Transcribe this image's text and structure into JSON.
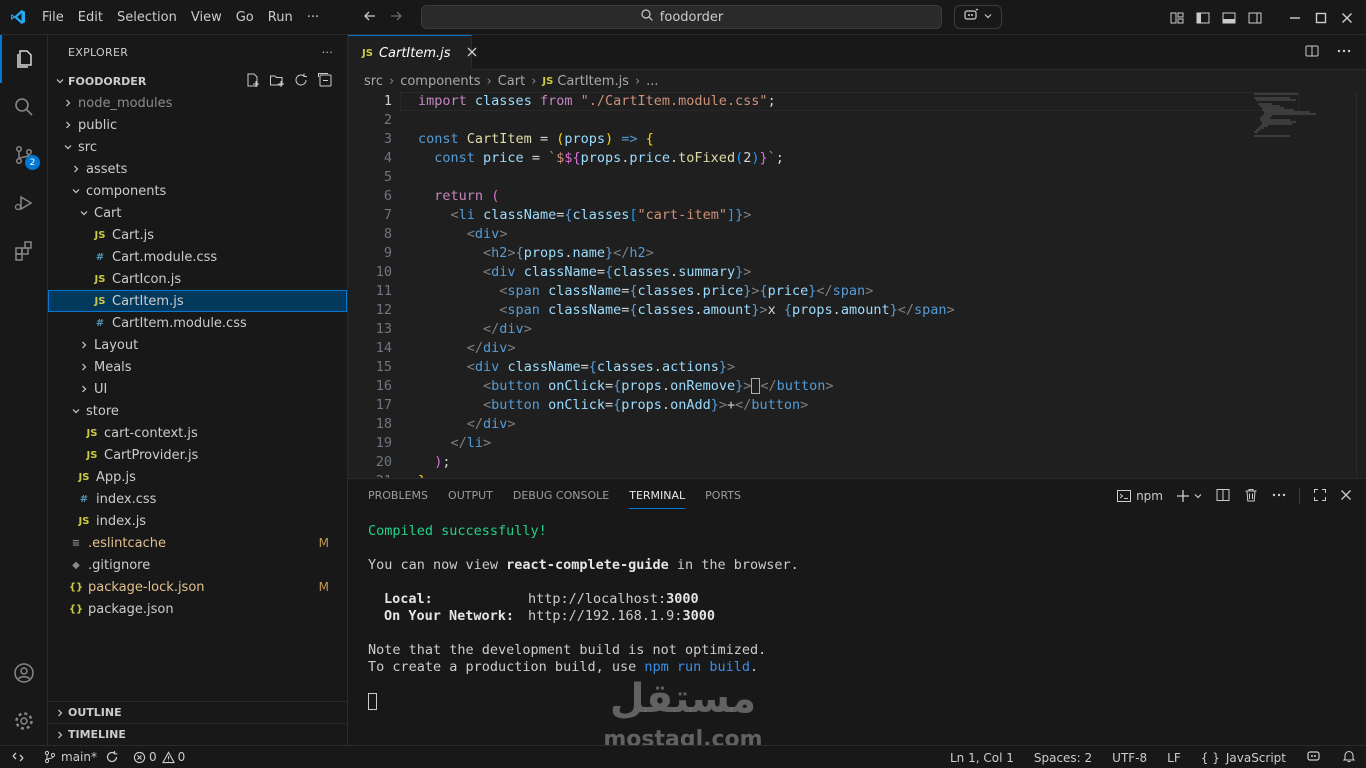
{
  "titlebar": {
    "menu": [
      "File",
      "Edit",
      "Selection",
      "View",
      "Go",
      "Run",
      "···"
    ],
    "search_text": "foodorder"
  },
  "activity": {
    "scm_badge": "2"
  },
  "sidebar": {
    "header": "EXPLORER",
    "more": "···",
    "project": "FOODORDER",
    "items": [
      {
        "label": "node_modules",
        "type": "folder",
        "depth": 0,
        "open": false,
        "muted": true
      },
      {
        "label": "public",
        "type": "folder",
        "depth": 0,
        "open": false
      },
      {
        "label": "src",
        "type": "folder",
        "depth": 0,
        "open": true
      },
      {
        "label": "assets",
        "type": "folder",
        "depth": 1,
        "open": false
      },
      {
        "label": "components",
        "type": "folder",
        "depth": 1,
        "open": true
      },
      {
        "label": "Cart",
        "type": "folder",
        "depth": 2,
        "open": true
      },
      {
        "label": "Cart.js",
        "type": "js",
        "depth": 3
      },
      {
        "label": "Cart.module.css",
        "type": "css",
        "depth": 3
      },
      {
        "label": "CartIcon.js",
        "type": "js",
        "depth": 3
      },
      {
        "label": "CartItem.js",
        "type": "js",
        "depth": 3,
        "selected": true
      },
      {
        "label": "CartItem.module.css",
        "type": "css",
        "depth": 3
      },
      {
        "label": "Layout",
        "type": "folder",
        "depth": 2,
        "open": false
      },
      {
        "label": "Meals",
        "type": "folder",
        "depth": 2,
        "open": false
      },
      {
        "label": "UI",
        "type": "folder",
        "depth": 2,
        "open": false
      },
      {
        "label": "store",
        "type": "folder",
        "depth": 1,
        "open": true
      },
      {
        "label": "cart-context.js",
        "type": "js",
        "depth": 2
      },
      {
        "label": "CartProvider.js",
        "type": "js",
        "depth": 2
      },
      {
        "label": "App.js",
        "type": "js",
        "depth": 1
      },
      {
        "label": "index.css",
        "type": "css",
        "depth": 1
      },
      {
        "label": "index.js",
        "type": "js",
        "depth": 1
      },
      {
        "label": ".eslintcache",
        "type": "lines",
        "depth": 0,
        "modified": "M"
      },
      {
        "label": ".gitignore",
        "type": "git",
        "depth": 0
      },
      {
        "label": "package-lock.json",
        "type": "json",
        "depth": 0,
        "modified": "M"
      },
      {
        "label": "package.json",
        "type": "json",
        "depth": 0
      }
    ],
    "outline": "OUTLINE",
    "timeline": "TIMELINE"
  },
  "editor": {
    "tab_label": "CartItem.js",
    "tab_icon": "JS",
    "breadcrumb": [
      "src",
      "components",
      "Cart",
      "CartItem.js",
      "..."
    ],
    "current_line": 1,
    "lines": [
      [
        [
          "kw",
          "import"
        ],
        [
          "pl",
          " "
        ],
        [
          "vr",
          "classes"
        ],
        [
          "pl",
          " "
        ],
        [
          "kw",
          "from"
        ],
        [
          "pl",
          " "
        ],
        [
          "st",
          "\"./CartItem.module.css\""
        ],
        [
          "pl",
          ";"
        ]
      ],
      [],
      [
        [
          "kb",
          "const"
        ],
        [
          "pl",
          " "
        ],
        [
          "fn",
          "CartItem"
        ],
        [
          "pl",
          " = "
        ],
        [
          "br",
          "("
        ],
        [
          "vr",
          "props"
        ],
        [
          "br",
          ")"
        ],
        [
          "pl",
          " "
        ],
        [
          "kb",
          "=>"
        ],
        [
          "pl",
          " "
        ],
        [
          "br",
          "{"
        ]
      ],
      [
        [
          "pl",
          "  "
        ],
        [
          "kb",
          "const"
        ],
        [
          "pl",
          " "
        ],
        [
          "vr",
          "price"
        ],
        [
          "pl",
          " = "
        ],
        [
          "st",
          "`$"
        ],
        [
          "br2",
          "${"
        ],
        [
          "vr",
          "props"
        ],
        [
          "pl",
          "."
        ],
        [
          "vr",
          "price"
        ],
        [
          "pl",
          "."
        ],
        [
          "fn",
          "toFixed"
        ],
        [
          "br3",
          "("
        ],
        [
          "pl",
          "2"
        ],
        [
          "br3",
          ")"
        ],
        [
          "br2",
          "}"
        ],
        [
          "st",
          "`"
        ],
        [
          "pl",
          ";"
        ]
      ],
      [],
      [
        [
          "pl",
          "  "
        ],
        [
          "kw",
          "return"
        ],
        [
          "pl",
          " "
        ],
        [
          "br2",
          "("
        ]
      ],
      [
        [
          "pl",
          "    "
        ],
        [
          "ang",
          "<"
        ],
        [
          "tg",
          "li"
        ],
        [
          "pl",
          " "
        ],
        [
          "at",
          "className"
        ],
        [
          "pl",
          "="
        ],
        [
          "kb",
          "{"
        ],
        [
          "vr",
          "classes"
        ],
        [
          "br3",
          "["
        ],
        [
          "st",
          "\"cart-item\""
        ],
        [
          "br3",
          "]"
        ],
        [
          "kb",
          "}"
        ],
        [
          "ang",
          ">"
        ]
      ],
      [
        [
          "pl",
          "      "
        ],
        [
          "ang",
          "<"
        ],
        [
          "tg",
          "div"
        ],
        [
          "ang",
          ">"
        ]
      ],
      [
        [
          "pl",
          "        "
        ],
        [
          "ang",
          "<"
        ],
        [
          "tg",
          "h2"
        ],
        [
          "ang",
          ">"
        ],
        [
          "kb",
          "{"
        ],
        [
          "vr",
          "props"
        ],
        [
          "pl",
          "."
        ],
        [
          "vr",
          "name"
        ],
        [
          "kb",
          "}"
        ],
        [
          "ang",
          "</"
        ],
        [
          "tg",
          "h2"
        ],
        [
          "ang",
          ">"
        ]
      ],
      [
        [
          "pl",
          "        "
        ],
        [
          "ang",
          "<"
        ],
        [
          "tg",
          "div"
        ],
        [
          "pl",
          " "
        ],
        [
          "at",
          "className"
        ],
        [
          "pl",
          "="
        ],
        [
          "kb",
          "{"
        ],
        [
          "vr",
          "classes"
        ],
        [
          "pl",
          "."
        ],
        [
          "vr",
          "summary"
        ],
        [
          "kb",
          "}"
        ],
        [
          "ang",
          ">"
        ]
      ],
      [
        [
          "pl",
          "          "
        ],
        [
          "ang",
          "<"
        ],
        [
          "tg",
          "span"
        ],
        [
          "pl",
          " "
        ],
        [
          "at",
          "className"
        ],
        [
          "pl",
          "="
        ],
        [
          "kb",
          "{"
        ],
        [
          "vr",
          "classes"
        ],
        [
          "pl",
          "."
        ],
        [
          "vr",
          "price"
        ],
        [
          "kb",
          "}"
        ],
        [
          "ang",
          ">"
        ],
        [
          "kb",
          "{"
        ],
        [
          "vr",
          "price"
        ],
        [
          "kb",
          "}"
        ],
        [
          "ang",
          "</"
        ],
        [
          "tg",
          "span"
        ],
        [
          "ang",
          ">"
        ]
      ],
      [
        [
          "pl",
          "          "
        ],
        [
          "ang",
          "<"
        ],
        [
          "tg",
          "span"
        ],
        [
          "pl",
          " "
        ],
        [
          "at",
          "className"
        ],
        [
          "pl",
          "="
        ],
        [
          "kb",
          "{"
        ],
        [
          "vr",
          "classes"
        ],
        [
          "pl",
          "."
        ],
        [
          "vr",
          "amount"
        ],
        [
          "kb",
          "}"
        ],
        [
          "ang",
          ">"
        ],
        [
          "pl",
          "x "
        ],
        [
          "kb",
          "{"
        ],
        [
          "vr",
          "props"
        ],
        [
          "pl",
          "."
        ],
        [
          "vr",
          "amount"
        ],
        [
          "kb",
          "}"
        ],
        [
          "ang",
          "</"
        ],
        [
          "tg",
          "span"
        ],
        [
          "ang",
          ">"
        ]
      ],
      [
        [
          "pl",
          "        "
        ],
        [
          "ang",
          "</"
        ],
        [
          "tg",
          "div"
        ],
        [
          "ang",
          ">"
        ]
      ],
      [
        [
          "pl",
          "      "
        ],
        [
          "ang",
          "</"
        ],
        [
          "tg",
          "div"
        ],
        [
          "ang",
          ">"
        ]
      ],
      [
        [
          "pl",
          "      "
        ],
        [
          "ang",
          "<"
        ],
        [
          "tg",
          "div"
        ],
        [
          "pl",
          " "
        ],
        [
          "at",
          "className"
        ],
        [
          "pl",
          "="
        ],
        [
          "kb",
          "{"
        ],
        [
          "vr",
          "classes"
        ],
        [
          "pl",
          "."
        ],
        [
          "vr",
          "actions"
        ],
        [
          "kb",
          "}"
        ],
        [
          "ang",
          ">"
        ]
      ],
      [
        [
          "pl",
          "        "
        ],
        [
          "ang",
          "<"
        ],
        [
          "tg",
          "button"
        ],
        [
          "pl",
          " "
        ],
        [
          "at",
          "onClick"
        ],
        [
          "pl",
          "="
        ],
        [
          "kb",
          "{"
        ],
        [
          "vr",
          "props"
        ],
        [
          "pl",
          "."
        ],
        [
          "vr",
          "onRemove"
        ],
        [
          "kb",
          "}"
        ],
        [
          "ang",
          ">"
        ],
        [
          "cursor",
          "−"
        ],
        [
          "ang",
          "</"
        ],
        [
          "tg",
          "button"
        ],
        [
          "ang",
          ">"
        ]
      ],
      [
        [
          "pl",
          "        "
        ],
        [
          "ang",
          "<"
        ],
        [
          "tg",
          "button"
        ],
        [
          "pl",
          " "
        ],
        [
          "at",
          "onClick"
        ],
        [
          "pl",
          "="
        ],
        [
          "kb",
          "{"
        ],
        [
          "vr",
          "props"
        ],
        [
          "pl",
          "."
        ],
        [
          "vr",
          "onAdd"
        ],
        [
          "kb",
          "}"
        ],
        [
          "ang",
          ">"
        ],
        [
          "pl",
          "+"
        ],
        [
          "ang",
          "</"
        ],
        [
          "tg",
          "button"
        ],
        [
          "ang",
          ">"
        ]
      ],
      [
        [
          "pl",
          "      "
        ],
        [
          "ang",
          "</"
        ],
        [
          "tg",
          "div"
        ],
        [
          "ang",
          ">"
        ]
      ],
      [
        [
          "pl",
          "    "
        ],
        [
          "ang",
          "</"
        ],
        [
          "tg",
          "li"
        ],
        [
          "ang",
          ">"
        ]
      ],
      [
        [
          "pl",
          "  "
        ],
        [
          "br2",
          ")"
        ],
        [
          "pl",
          ";"
        ]
      ],
      [
        [
          "br",
          "}"
        ],
        [
          "pl",
          ";"
        ]
      ]
    ]
  },
  "panel": {
    "tabs": [
      "PROBLEMS",
      "OUTPUT",
      "DEBUG CONSOLE",
      "TERMINAL",
      "PORTS"
    ],
    "active_tab": "TERMINAL",
    "shell": "npm",
    "terminal": {
      "compiled": "Compiled successfully!",
      "view_pre": "You can now view ",
      "app_name": "react-complete-guide",
      "view_post": " in the browser.",
      "local_label": "Local:",
      "local_url_pre": "http://localhost:",
      "local_port": "3000",
      "network_label": "On Your Network:",
      "network_url_pre": "http://192.168.1.9:",
      "network_port": "3000",
      "note1": "Note that the development build is not optimized.",
      "note2_pre": "To create a production build, use ",
      "note2_cmd": "npm run build",
      "note2_post": "."
    }
  },
  "watermark": {
    "arabic": "مستقل",
    "latin": "mostaql.com"
  },
  "statusbar": {
    "branch": "main*",
    "errors": "0",
    "warnings": "0",
    "position": "Ln 1, Col 1",
    "spaces": "Spaces: 2",
    "encoding": "UTF-8",
    "eol": "LF",
    "language": "JavaScript",
    "language_braces": "{ }"
  },
  "colors": {
    "accent": "#0078d4",
    "selection": "#04395e",
    "js": "#cbcb41",
    "css": "#519aba",
    "modified": "#c09553"
  }
}
